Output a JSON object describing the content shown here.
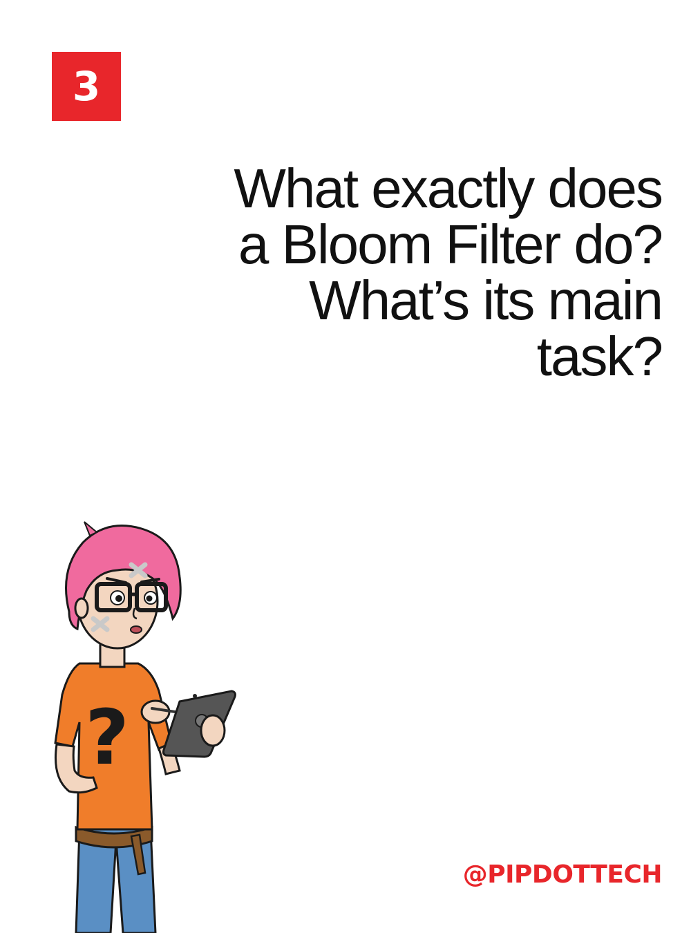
{
  "slide": {
    "number": "3",
    "question_lines": [
      "What exactly does",
      "a Bloom Filter do?",
      "What’s its main",
      "task?"
    ],
    "handle": "@PIPDOTTECH"
  },
  "colors": {
    "accent_red": "#e8262b",
    "text": "#111111",
    "hair": "#f06a9e",
    "shirt": "#f07d2a",
    "jeans": "#5a8fc4",
    "tablet": "#555555"
  },
  "icons": {
    "character": "character-illustration"
  }
}
